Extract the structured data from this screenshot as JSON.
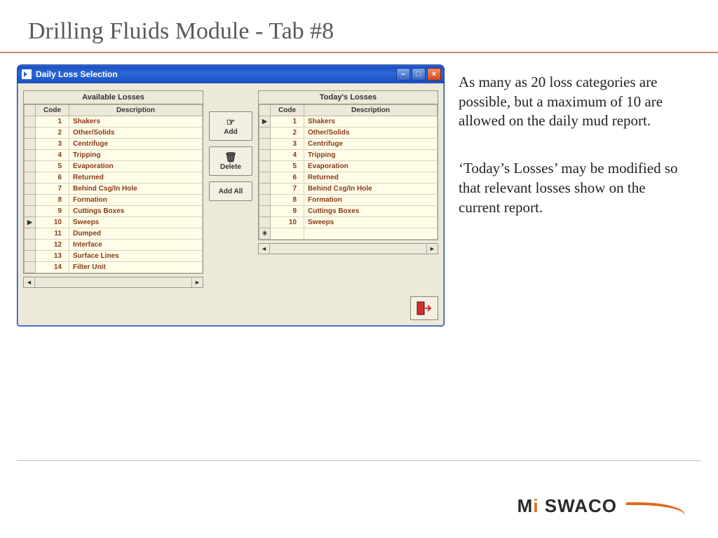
{
  "title": "Drilling Fluids Module  -  Tab #8",
  "windowTitle": "Daily Loss Selection",
  "panels": {
    "available": {
      "title": "Available Losses",
      "headers": {
        "code": "Code",
        "desc": "Description"
      },
      "rows": [
        {
          "code": "1",
          "desc": "Shakers"
        },
        {
          "code": "2",
          "desc": "Other/Solids"
        },
        {
          "code": "3",
          "desc": "Centrifuge"
        },
        {
          "code": "4",
          "desc": "Tripping"
        },
        {
          "code": "5",
          "desc": "Evaporation"
        },
        {
          "code": "6",
          "desc": "Returned"
        },
        {
          "code": "7",
          "desc": "Behind Csg/In Hole"
        },
        {
          "code": "8",
          "desc": "Formation"
        },
        {
          "code": "9",
          "desc": "Cuttings Boxes"
        },
        {
          "code": "10",
          "desc": "Sweeps",
          "selected": true
        },
        {
          "code": "11",
          "desc": "Dumped"
        },
        {
          "code": "12",
          "desc": "Interface"
        },
        {
          "code": "13",
          "desc": "Surface Lines"
        },
        {
          "code": "14",
          "desc": "Filter Unit"
        }
      ]
    },
    "today": {
      "title": "Today's Losses",
      "headers": {
        "code": "Code",
        "desc": "Description"
      },
      "rows": [
        {
          "code": "1",
          "desc": "Shakers",
          "selected": true
        },
        {
          "code": "2",
          "desc": "Other/Solids"
        },
        {
          "code": "3",
          "desc": "Centrifuge"
        },
        {
          "code": "4",
          "desc": "Tripping"
        },
        {
          "code": "5",
          "desc": "Evaporation"
        },
        {
          "code": "6",
          "desc": "Returned"
        },
        {
          "code": "7",
          "desc": "Behind Csg/In Hole"
        },
        {
          "code": "8",
          "desc": "Formation"
        },
        {
          "code": "9",
          "desc": "Cuttings Boxes"
        },
        {
          "code": "10",
          "desc": "Sweeps"
        }
      ],
      "hasNewRow": true
    }
  },
  "buttons": {
    "add": "Add",
    "delete": "Delete",
    "addAll": "Add All"
  },
  "body": {
    "p1": "As many as 20 loss categories are possible, but a maximum of 10 are allowed on the daily mud report.",
    "p2": "‘Today’s Losses’ may be modified so that relevant losses show on the current report."
  },
  "logo": {
    "m": "M",
    "i": "i",
    "rest": " SWACO"
  }
}
